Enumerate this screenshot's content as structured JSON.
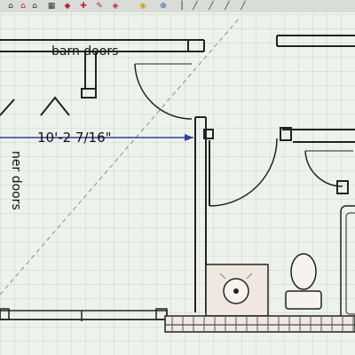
{
  "toolbar": {
    "icons": [
      "house-icon",
      "roof-icon",
      "door-icon",
      "palette-icon",
      "tape-icon",
      "pencil-icon",
      "camera-icon",
      "pointer-icon"
    ]
  },
  "plan": {
    "barn_doors_label": "barn doors",
    "dimension_label": "10'-2 7/16\"",
    "vertical_label": "ner doors"
  },
  "colors": {
    "grid": "#c9d4cb",
    "wall": "#222222",
    "dimension": "#2f3f9a",
    "fixture_fill": "#efe7e0"
  }
}
